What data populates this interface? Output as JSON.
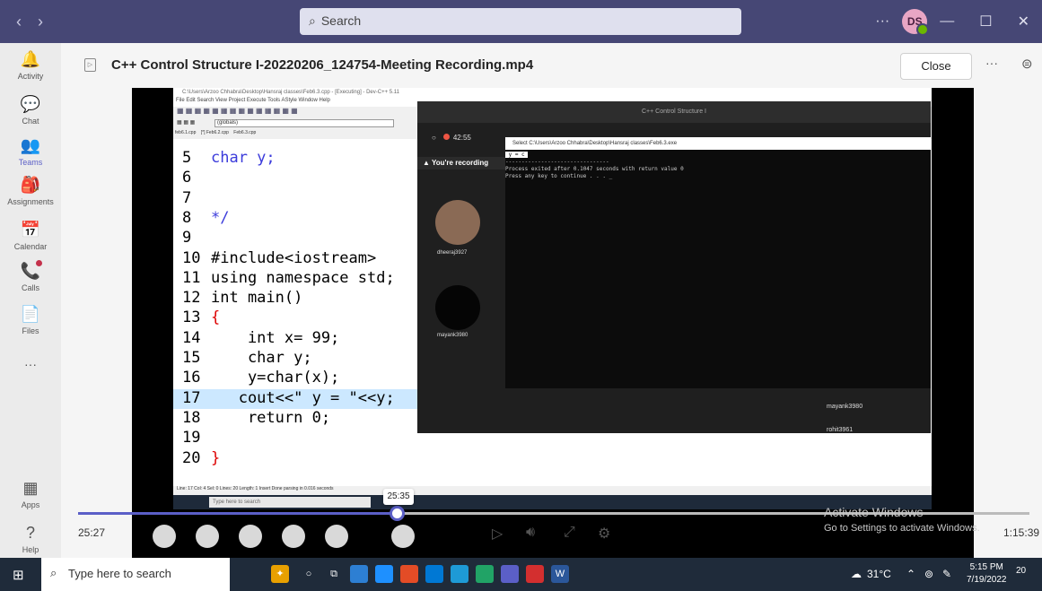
{
  "titlebar": {
    "search_placeholder": "Search",
    "more": "···",
    "avatar_initials": "DS",
    "minimize": "—",
    "maximize": "☐",
    "close": "✕"
  },
  "rail": [
    {
      "label": "Activity",
      "icon": "bell-icon",
      "glyph": "🔔"
    },
    {
      "label": "Chat",
      "icon": "chat-icon",
      "glyph": "💬"
    },
    {
      "label": "Teams",
      "icon": "teams-icon",
      "glyph": "👥"
    },
    {
      "label": "Assignments",
      "icon": "assignments-icon",
      "glyph": "🎒"
    },
    {
      "label": "Calendar",
      "icon": "calendar-icon",
      "glyph": "📅"
    },
    {
      "label": "Calls",
      "icon": "phone-icon",
      "glyph": "📞"
    },
    {
      "label": "Files",
      "icon": "file-icon",
      "glyph": "📄"
    },
    {
      "label": "···",
      "icon": "more-icon",
      "glyph": ""
    },
    {
      "label": "Apps",
      "icon": "apps-icon",
      "glyph": "▦"
    },
    {
      "label": "Help",
      "icon": "help-icon",
      "glyph": "?"
    }
  ],
  "header": {
    "title": "C++ Control Structure I-20220206_124754-Meeting Recording.mp4",
    "close_label": "Close",
    "more": "···"
  },
  "devcpp": {
    "title": "C:\\Users\\Arzoo Chhabra\\Desktop\\Hansraj classes\\Feb6.3.cpp - [Executing] - Dev-C++ 5.11",
    "menu": "File   Edit   Search   View   Project   Execute   Tools   AStyle   Window   Help",
    "globals": "(globals)",
    "tabs": [
      "feb6.1.cpp",
      "[*] Feb6.2.cpp",
      "Feb6.3.cpp"
    ],
    "status": "Line: 17      Col: 4       Sel: 0       Lines: 20       Length: 1          Insert        Done parsing in 0.016 seconds",
    "mini_search": "Type here to search",
    "code": [
      {
        "n": "5",
        "t": "char y;"
      },
      {
        "n": "6",
        "t": ""
      },
      {
        "n": "7",
        "t": ""
      },
      {
        "n": "8",
        "t": "*/"
      },
      {
        "n": "9",
        "t": ""
      },
      {
        "n": "10",
        "t": "#include<iostream>"
      },
      {
        "n": "11",
        "t": "using namespace std;"
      },
      {
        "n": "12",
        "t": "int main()"
      },
      {
        "n": "13",
        "t": "{"
      },
      {
        "n": "14",
        "t": "    int x= 99;"
      },
      {
        "n": "15",
        "t": "    char y;"
      },
      {
        "n": "16",
        "t": "    y=char(x);"
      },
      {
        "n": "17",
        "t": "   cout<<\" y = \"<<y;"
      },
      {
        "n": "18",
        "t": "    return 0;"
      },
      {
        "n": "19",
        "t": ""
      },
      {
        "n": "20",
        "t": "}"
      }
    ]
  },
  "meeting": {
    "window_title": "C++ Control Structure I",
    "timer": "42:55",
    "recording": "You're recording",
    "participants": [
      "dheeraj3927",
      "mayank3980"
    ],
    "list": [
      "mayank3980",
      "rohit3961"
    ]
  },
  "console": {
    "title": "Select C:\\Users\\Arzoo Chhabra\\Desktop\\Hansraj classes\\Feb6.3.exe",
    "line1": " y = c ",
    "line2": "--------------------------------",
    "line3": "Process exited after 0.1047 seconds with return value 0",
    "line4": "Press any key to continue . . . _"
  },
  "player": {
    "current": "25:27",
    "tooltip": "25:35",
    "total": "1:15:39",
    "progress": 0.336,
    "activate1": "Activate Windows",
    "activate2": "Go to Settings to activate Windows."
  },
  "taskbar": {
    "search": "Type here to search",
    "weather": "31°C",
    "time": "5:15 PM",
    "date": "7/19/2022",
    "notifications": "20"
  }
}
